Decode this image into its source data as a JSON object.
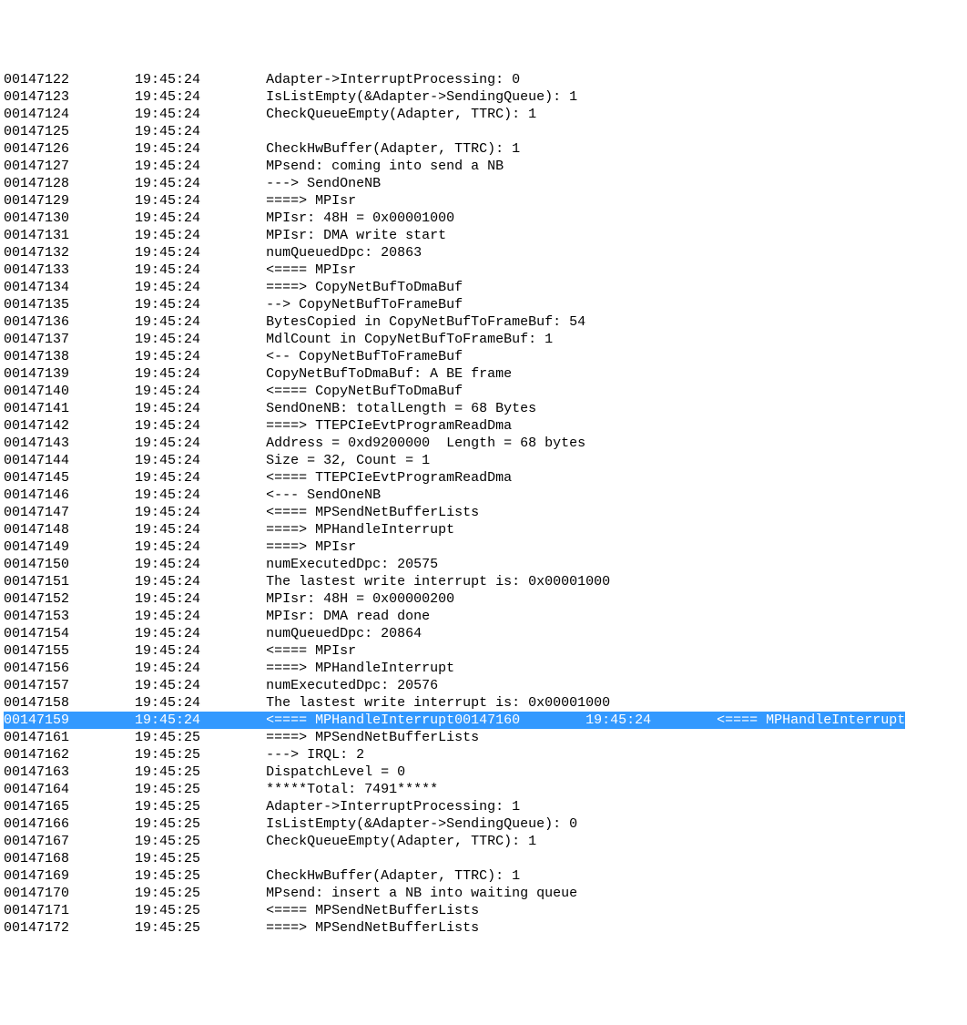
{
  "columns": {
    "seq_width": 16,
    "time_width": 16
  },
  "lines": [
    {
      "seq": "00147122",
      "time": "19:45:24",
      "msg": "Adapter->InterruptProcessing: 0",
      "selected": false
    },
    {
      "seq": "00147123",
      "time": "19:45:24",
      "msg": "IsListEmpty(&Adapter->SendingQueue): 1",
      "selected": false
    },
    {
      "seq": "00147124",
      "time": "19:45:24",
      "msg": "CheckQueueEmpty(Adapter, TTRC): 1",
      "selected": false
    },
    {
      "seq": "00147125",
      "time": "19:45:24",
      "msg": "",
      "selected": false
    },
    {
      "seq": "00147126",
      "time": "19:45:24",
      "msg": "CheckHwBuffer(Adapter, TTRC): 1",
      "selected": false
    },
    {
      "seq": "00147127",
      "time": "19:45:24",
      "msg": "MPsend: coming into send a NB",
      "selected": false
    },
    {
      "seq": "00147128",
      "time": "19:45:24",
      "msg": "---> SendOneNB",
      "selected": false
    },
    {
      "seq": "00147129",
      "time": "19:45:24",
      "msg": "====> MPIsr",
      "selected": false
    },
    {
      "seq": "00147130",
      "time": "19:45:24",
      "msg": "MPIsr: 48H = 0x00001000",
      "selected": false
    },
    {
      "seq": "00147131",
      "time": "19:45:24",
      "msg": "MPIsr: DMA write start",
      "selected": false
    },
    {
      "seq": "00147132",
      "time": "19:45:24",
      "msg": "numQueuedDpc: 20863",
      "selected": false
    },
    {
      "seq": "00147133",
      "time": "19:45:24",
      "msg": "<==== MPIsr",
      "selected": false
    },
    {
      "seq": "00147134",
      "time": "19:45:24",
      "msg": "====> CopyNetBufToDmaBuf",
      "selected": false
    },
    {
      "seq": "00147135",
      "time": "19:45:24",
      "msg": "--> CopyNetBufToFrameBuf",
      "selected": false
    },
    {
      "seq": "00147136",
      "time": "19:45:24",
      "msg": "BytesCopied in CopyNetBufToFrameBuf: 54",
      "selected": false
    },
    {
      "seq": "00147137",
      "time": "19:45:24",
      "msg": "MdlCount in CopyNetBufToFrameBuf: 1",
      "selected": false
    },
    {
      "seq": "00147138",
      "time": "19:45:24",
      "msg": "<-- CopyNetBufToFrameBuf",
      "selected": false
    },
    {
      "seq": "00147139",
      "time": "19:45:24",
      "msg": "CopyNetBufToDmaBuf: A BE frame",
      "selected": false
    },
    {
      "seq": "00147140",
      "time": "19:45:24",
      "msg": "<==== CopyNetBufToDmaBuf",
      "selected": false
    },
    {
      "seq": "00147141",
      "time": "19:45:24",
      "msg": "SendOneNB: totalLength = 68 Bytes",
      "selected": false
    },
    {
      "seq": "00147142",
      "time": "19:45:24",
      "msg": "====> TTEPCIeEvtProgramReadDma",
      "selected": false
    },
    {
      "seq": "00147143",
      "time": "19:45:24",
      "msg": "Address = 0xd9200000  Length = 68 bytes",
      "selected": false
    },
    {
      "seq": "00147144",
      "time": "19:45:24",
      "msg": "Size = 32, Count = 1",
      "selected": false
    },
    {
      "seq": "00147145",
      "time": "19:45:24",
      "msg": "<==== TTEPCIeEvtProgramReadDma",
      "selected": false
    },
    {
      "seq": "00147146",
      "time": "19:45:24",
      "msg": "<--- SendOneNB",
      "selected": false
    },
    {
      "seq": "00147147",
      "time": "19:45:24",
      "msg": "<==== MPSendNetBufferLists",
      "selected": false
    },
    {
      "seq": "00147148",
      "time": "19:45:24",
      "msg": "====> MPHandleInterrupt",
      "selected": false
    },
    {
      "seq": "00147149",
      "time": "19:45:24",
      "msg": "====> MPIsr",
      "selected": false
    },
    {
      "seq": "00147150",
      "time": "19:45:24",
      "msg": "numExecutedDpc: 20575",
      "selected": false
    },
    {
      "seq": "00147151",
      "time": "19:45:24",
      "msg": "The lastest write interrupt is: 0x00001000",
      "selected": false
    },
    {
      "seq": "00147152",
      "time": "19:45:24",
      "msg": "MPIsr: 48H = 0x00000200",
      "selected": false
    },
    {
      "seq": "00147153",
      "time": "19:45:24",
      "msg": "MPIsr: DMA read done",
      "selected": false
    },
    {
      "seq": "00147154",
      "time": "19:45:24",
      "msg": "numQueuedDpc: 20864",
      "selected": false
    },
    {
      "seq": "00147155",
      "time": "19:45:24",
      "msg": "<==== MPIsr",
      "selected": false
    },
    {
      "seq": "00147156",
      "time": "19:45:24",
      "msg": "====> MPHandleInterrupt",
      "selected": false
    },
    {
      "seq": "00147157",
      "time": "19:45:24",
      "msg": "numExecutedDpc: 20576",
      "selected": false
    },
    {
      "seq": "00147158",
      "time": "19:45:24",
      "msg": "The lastest write interrupt is: 0x00001000",
      "selected": false
    },
    {
      "seq": "00147159",
      "time": "19:45:24",
      "msg": "<==== MPHandleInterrupt",
      "selected": true
    },
    {
      "seq": "00147160",
      "time": "19:45:24",
      "msg": "<==== MPHandleInterrupt",
      "selected": true
    },
    {
      "seq": "00147161",
      "time": "19:45:25",
      "msg": "====> MPSendNetBufferLists",
      "selected": false
    },
    {
      "seq": "00147162",
      "time": "19:45:25",
      "msg": "---> IRQL: 2",
      "selected": false
    },
    {
      "seq": "00147163",
      "time": "19:45:25",
      "msg": "DispatchLevel = 0",
      "selected": false
    },
    {
      "seq": "00147164",
      "time": "19:45:25",
      "msg": "*****Total: 7491*****",
      "selected": false
    },
    {
      "seq": "00147165",
      "time": "19:45:25",
      "msg": "Adapter->InterruptProcessing: 1",
      "selected": false
    },
    {
      "seq": "00147166",
      "time": "19:45:25",
      "msg": "IsListEmpty(&Adapter->SendingQueue): 0",
      "selected": false
    },
    {
      "seq": "00147167",
      "time": "19:45:25",
      "msg": "CheckQueueEmpty(Adapter, TTRC): 1",
      "selected": false
    },
    {
      "seq": "00147168",
      "time": "19:45:25",
      "msg": "",
      "selected": false
    },
    {
      "seq": "00147169",
      "time": "19:45:25",
      "msg": "CheckHwBuffer(Adapter, TTRC): 1",
      "selected": false
    },
    {
      "seq": "00147170",
      "time": "19:45:25",
      "msg": "MPsend: insert a NB into waiting queue",
      "selected": false
    },
    {
      "seq": "00147171",
      "time": "19:45:25",
      "msg": "<==== MPSendNetBufferLists",
      "selected": false
    },
    {
      "seq": "00147172",
      "time": "19:45:25",
      "msg": "====> MPSendNetBufferLists",
      "selected": false
    }
  ]
}
